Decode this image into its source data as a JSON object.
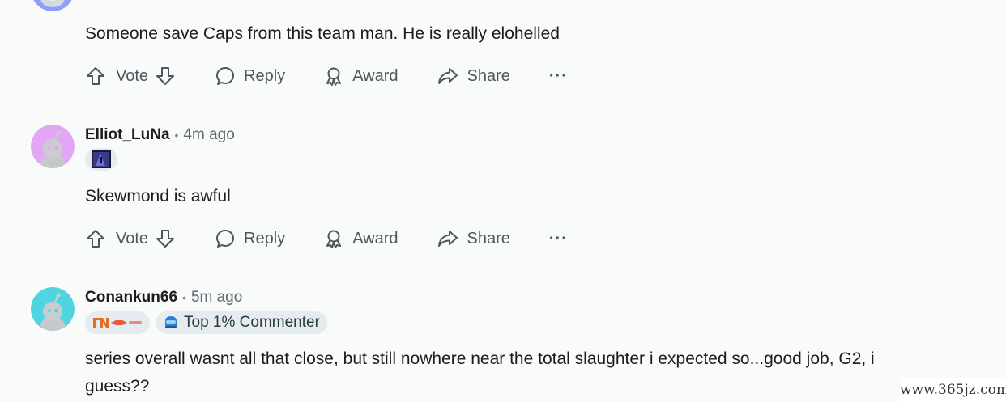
{
  "comments": [
    {
      "body": "Someone save Caps from this team man. He is really elohelled",
      "avatar_color": "#8c9eff"
    },
    {
      "author": "Elliot_LuNa",
      "time": "4m ago",
      "body": "Skewmond is awful",
      "avatar_color": "#e3a6f5"
    },
    {
      "author": "Conankun66",
      "time": "5m ago",
      "badge": "Top 1% Commenter",
      "body_line1": "series overall wasnt all that close, but still nowhere near the total slaughter i expected so...good job, G2, i",
      "body_line2": "guess??",
      "avatar_color": "#4fd4e0"
    }
  ],
  "actions": {
    "vote": "Vote",
    "reply": "Reply",
    "award": "Award",
    "share": "Share",
    "more": "···"
  },
  "separator": "•",
  "watermark": "www.365jz.com",
  "icons": [
    "upvote-icon",
    "downvote-icon",
    "reply-icon",
    "award-icon",
    "share-icon",
    "more-icon"
  ]
}
